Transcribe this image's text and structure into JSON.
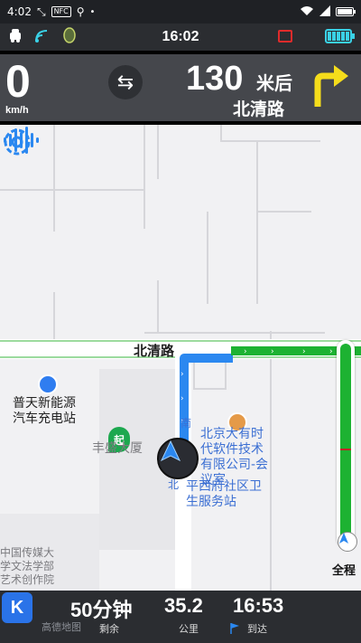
{
  "statusbar": {
    "time": "4:02",
    "nfc": "NFC"
  },
  "navbar": {
    "clock": "16:02"
  },
  "guidance": {
    "speed": "0",
    "speed_unit": "km/h",
    "distance": "130",
    "distance_unit": "米后",
    "road": "北清路"
  },
  "map": {
    "road_label": "北清路",
    "pois": [
      {
        "name": "普天新能源汽车充电站"
      },
      {
        "name": "丰盛大厦"
      },
      {
        "name": "北京大有时代软件技术有限公司-会议室"
      },
      {
        "name": "平西府社区卫生服务站"
      },
      {
        "name": "中国传媒大学文法学部艺术创作院"
      }
    ],
    "start_marker": "起",
    "road_char_1": "南",
    "road_char_2": "北",
    "overview_label": "全程"
  },
  "route_progress_fraction": 0.48,
  "bottom": {
    "remaining_time": "50分钟",
    "remaining_time_label": "剩余",
    "distance": "35.2",
    "distance_label": "公里",
    "eta": "16:53",
    "eta_label": "到达",
    "brand": "高德地图",
    "app_letter": "K"
  },
  "colors": {
    "route_blue": "#2b88f0",
    "route_green": "#1db232",
    "turn_arrow": "#f5dd1b",
    "battery_cyan": "#3ad1e6"
  }
}
